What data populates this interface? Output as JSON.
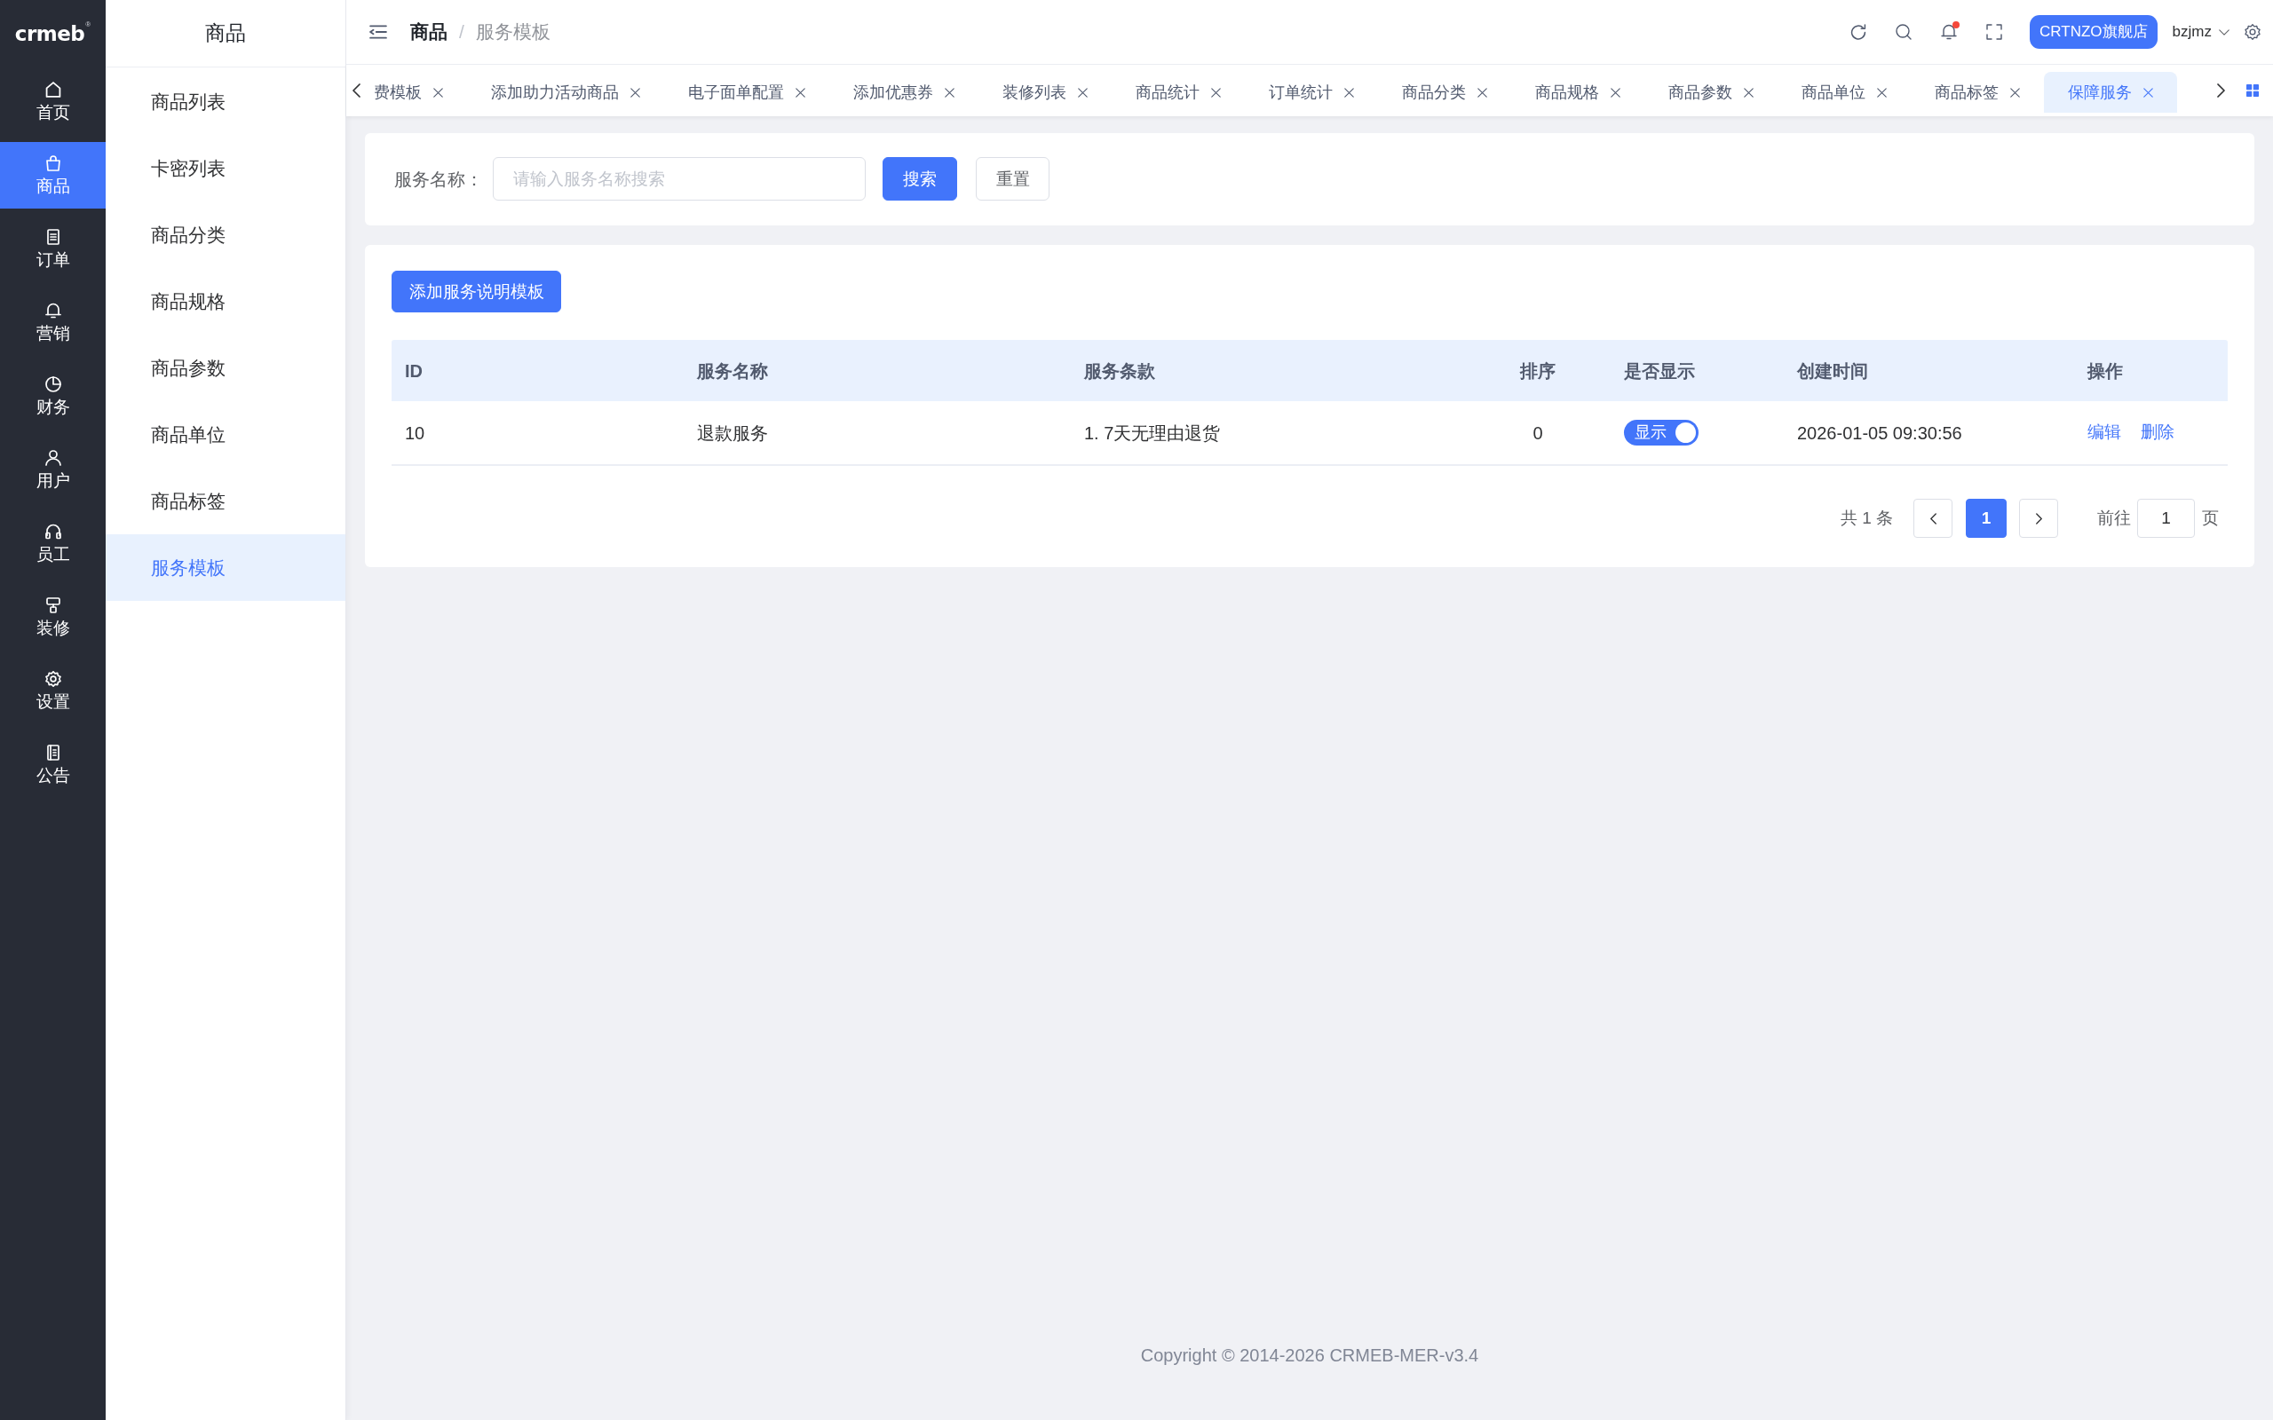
{
  "logo": {
    "text": "crmeb",
    "registered": "®"
  },
  "nav": [
    {
      "label": "首页",
      "selected": false
    },
    {
      "label": "商品",
      "selected": true
    },
    {
      "label": "订单",
      "selected": false
    },
    {
      "label": "营销",
      "selected": false
    },
    {
      "label": "财务",
      "selected": false
    },
    {
      "label": "用户",
      "selected": false
    },
    {
      "label": "员工",
      "selected": false
    },
    {
      "label": "装修",
      "selected": false
    },
    {
      "label": "设置",
      "selected": false
    },
    {
      "label": "公告",
      "selected": false
    }
  ],
  "submenu": {
    "title": "商品",
    "items": [
      {
        "label": "商品列表",
        "selected": false
      },
      {
        "label": "卡密列表",
        "selected": false
      },
      {
        "label": "商品分类",
        "selected": false
      },
      {
        "label": "商品规格",
        "selected": false
      },
      {
        "label": "商品参数",
        "selected": false
      },
      {
        "label": "商品单位",
        "selected": false
      },
      {
        "label": "商品标签",
        "selected": false
      },
      {
        "label": "服务模板",
        "selected": true
      }
    ]
  },
  "header": {
    "breadcrumb": [
      {
        "label": "商品",
        "current": false
      },
      {
        "label": "服务模板",
        "current": true
      }
    ],
    "separator": "/",
    "notifications_unread": true,
    "store_button": "CRTNZO旗舰店",
    "user": "bzjmz"
  },
  "tabs": [
    {
      "label": "费模板",
      "selected": false
    },
    {
      "label": "添加助力活动商品",
      "selected": false
    },
    {
      "label": "电子面单配置",
      "selected": false
    },
    {
      "label": "添加优惠券",
      "selected": false
    },
    {
      "label": "装修列表",
      "selected": false
    },
    {
      "label": "商品统计",
      "selected": false
    },
    {
      "label": "订单统计",
      "selected": false
    },
    {
      "label": "商品分类",
      "selected": false
    },
    {
      "label": "商品规格",
      "selected": false
    },
    {
      "label": "商品参数",
      "selected": false
    },
    {
      "label": "商品单位",
      "selected": false
    },
    {
      "label": "商品标签",
      "selected": false
    },
    {
      "label": "保障服务",
      "selected": true
    }
  ],
  "search": {
    "label": "服务名称：",
    "placeholder": "请输入服务名称搜索",
    "search_button": "搜索",
    "reset_button": "重置"
  },
  "table_card": {
    "add_button": "添加服务说明模板",
    "columns": [
      "ID",
      "服务名称",
      "服务条款",
      "排序",
      "是否显示",
      "创建时间",
      "操作"
    ],
    "rows": [
      {
        "id": "10",
        "name": "退款服务",
        "terms": "1. 7天无理由退货",
        "sort": "0",
        "display": {
          "label": "显示",
          "on": true
        },
        "created_at": "2026-01-05 09:30:56",
        "actions": [
          "编辑",
          "删除"
        ]
      }
    ]
  },
  "pagination": {
    "total": "共 1 条",
    "pages": [
      {
        "label": "1",
        "selected": true
      }
    ],
    "goto_label": "前往",
    "goto_value": "1",
    "suffix": "页"
  },
  "footer": "Copyright © 2014-2026 CRMEB-MER-v3.4"
}
